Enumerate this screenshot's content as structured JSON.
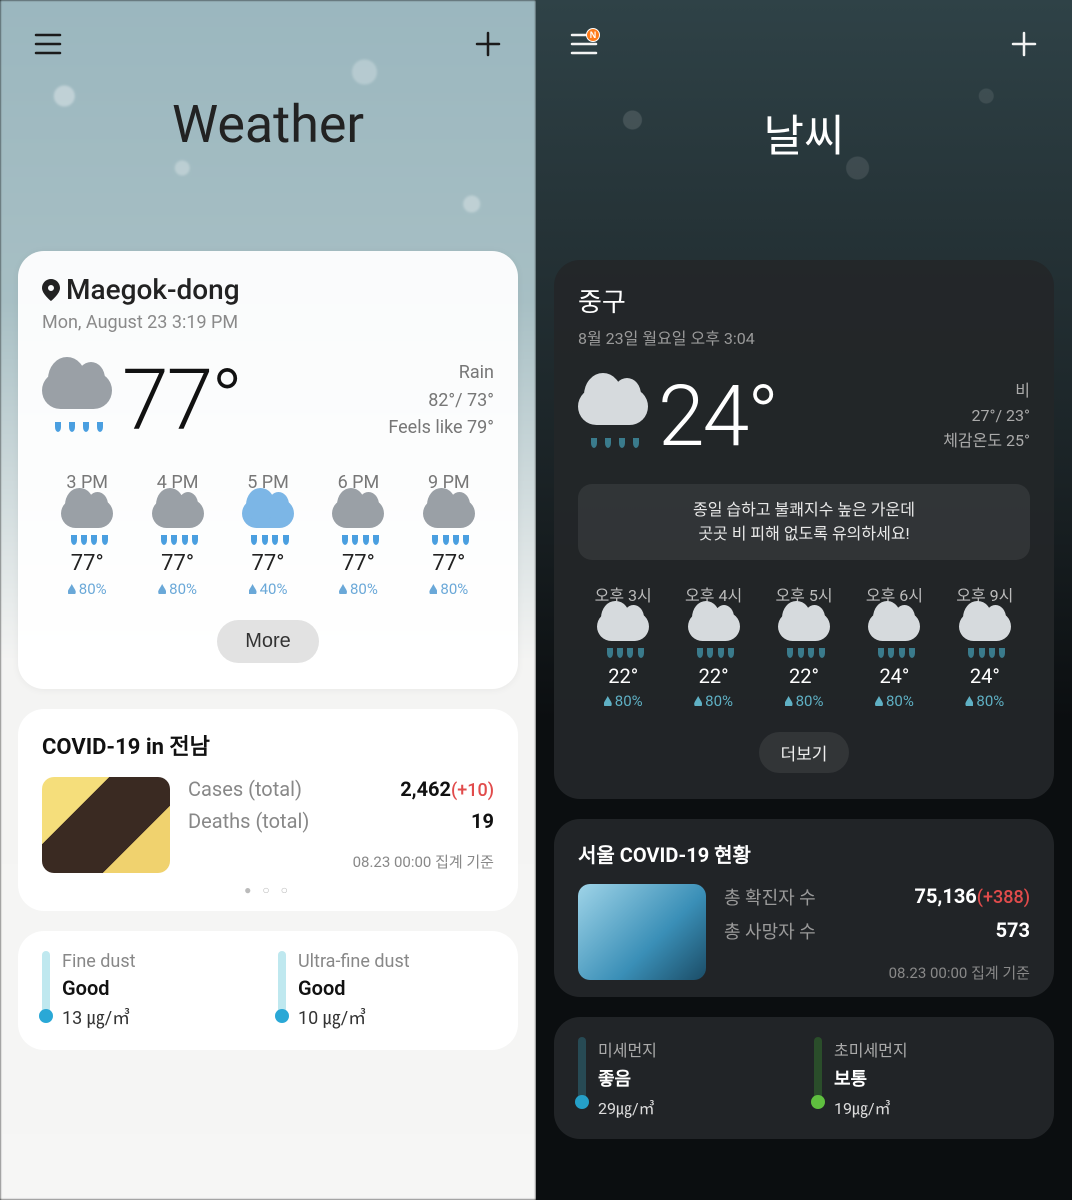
{
  "left": {
    "title": "Weather",
    "notification_badge": false,
    "location": "Maegok-dong",
    "timestamp": "Mon, August 23 3:19 PM",
    "current": {
      "temp": "77°",
      "condition": "Rain",
      "high_low": "82°/ 73°",
      "feels": "Feels like 79°"
    },
    "hourly": [
      {
        "time": "3 PM",
        "temp": "77°",
        "precip": "80%",
        "blue": false
      },
      {
        "time": "4 PM",
        "temp": "77°",
        "precip": "80%",
        "blue": false
      },
      {
        "time": "5 PM",
        "temp": "77°",
        "precip": "40%",
        "blue": true
      },
      {
        "time": "6 PM",
        "temp": "77°",
        "precip": "80%",
        "blue": false
      },
      {
        "time": "9 PM",
        "temp": "77°",
        "precip": "80%",
        "blue": false
      }
    ],
    "more_label": "More",
    "covid": {
      "title": "COVID-19 in 전남",
      "cases_label": "Cases (total)",
      "cases_value": "2,462",
      "cases_delta": "(+10)",
      "deaths_label": "Deaths (total)",
      "deaths_value": "19",
      "timestamp": "08.23 00:00 집계 기준",
      "dots": "● ○ ○"
    },
    "air": {
      "pm10": {
        "label": "Fine dust",
        "status": "Good",
        "value": "13 ㎍/㎥",
        "bar": "#bfe8ef",
        "dot": "#2aa8d6"
      },
      "pm25": {
        "label": "Ultra-fine dust",
        "status": "Good",
        "value": "10 ㎍/㎥",
        "bar": "#bfe8ef",
        "dot": "#2aa8d6"
      }
    }
  },
  "right": {
    "title": "날씨",
    "notification_badge": true,
    "badge_text": "N",
    "location": "중구",
    "timestamp": "8월 23일 월요일 오후 3:04",
    "current": {
      "temp": "24°",
      "condition": "비",
      "high_low": "27°/ 23°",
      "feels": "체감온도 25°"
    },
    "banner_line1": "종일 습하고 불쾌지수 높은 가운데",
    "banner_line2": "곳곳 비 피해 없도록 유의하세요!",
    "hourly": [
      {
        "time": "오후 3시",
        "temp": "22°",
        "precip": "80%"
      },
      {
        "time": "오후 4시",
        "temp": "22°",
        "precip": "80%"
      },
      {
        "time": "오후 5시",
        "temp": "22°",
        "precip": "80%"
      },
      {
        "time": "오후 6시",
        "temp": "24°",
        "precip": "80%"
      },
      {
        "time": "오후 9시",
        "temp": "24°",
        "precip": "80%"
      }
    ],
    "more_label": "더보기",
    "covid": {
      "title": "서울 COVID-19 현황",
      "cases_label": "총 확진자 수",
      "cases_value": "75,136",
      "cases_delta": "(+388)",
      "deaths_label": "총 사망자 수",
      "deaths_value": "573",
      "timestamp": "08.23 00:00 집계 기준"
    },
    "air": {
      "pm10": {
        "label": "미세먼지",
        "status": "좋음",
        "value": "29㎍/㎥",
        "bar": "#274a54",
        "dot": "#25a0c8"
      },
      "pm25": {
        "label": "초미세먼지",
        "status": "보통",
        "value": "19㎍/㎥",
        "bar": "#2a4d2a",
        "dot": "#5fbf3f"
      }
    }
  }
}
